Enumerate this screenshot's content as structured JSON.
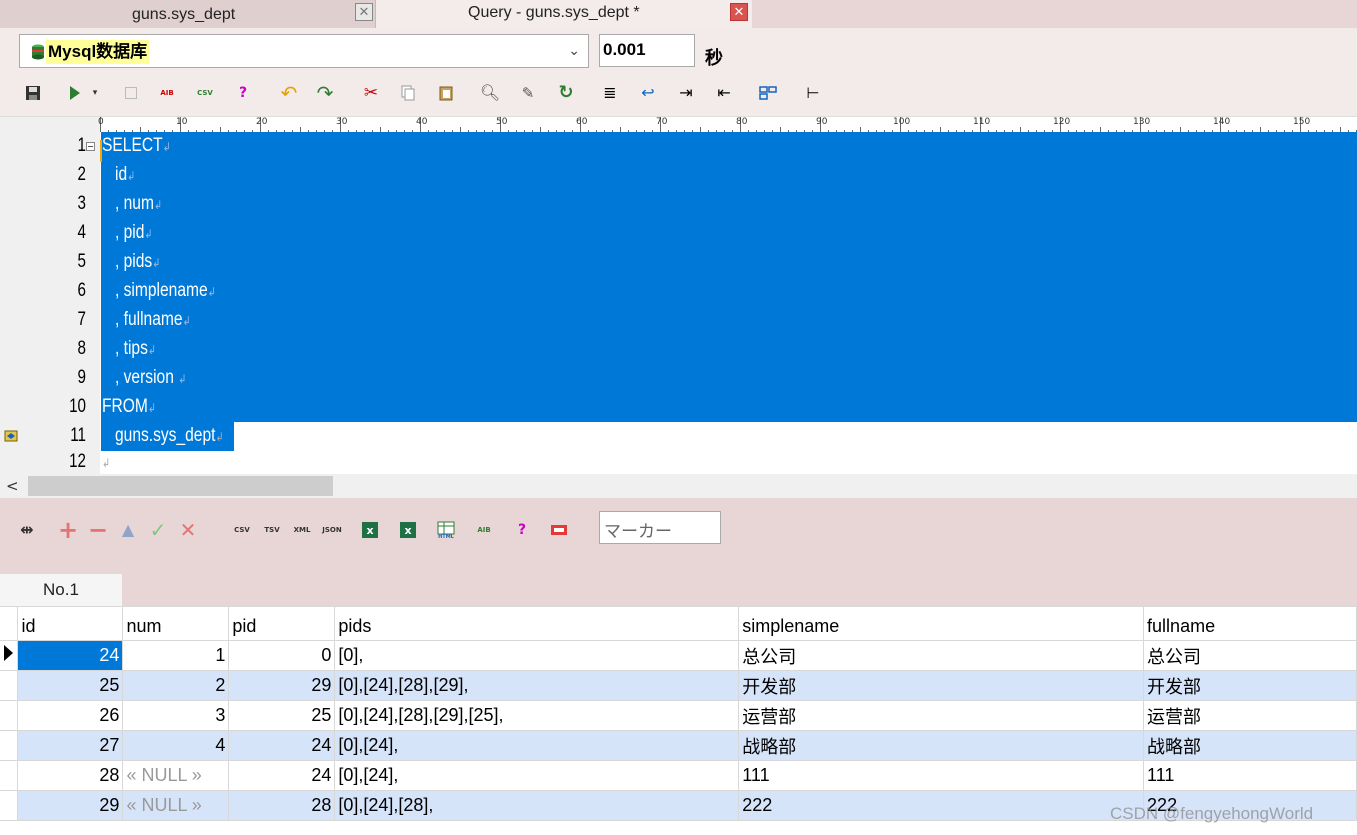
{
  "tabs": [
    {
      "label": "guns.sys_dept",
      "active": false
    },
    {
      "label": "Query - guns.sys_dept *",
      "active": true
    }
  ],
  "connection": {
    "database": "Mysql数据库",
    "exec_time": "0.001",
    "time_unit": "秒"
  },
  "toolbar_icons": [
    "save-icon",
    "run-icon",
    "stop-icon",
    "export-aib-icon",
    "export-csv-icon",
    "help-query-icon",
    "undo-icon",
    "redo-icon",
    "cut-icon",
    "copy-icon",
    "paste-icon",
    "find-icon",
    "replace-icon",
    "goto-icon",
    "align-left-icon",
    "wrap-icon",
    "indent-icon",
    "outdent-icon",
    "layout-icon",
    "tree-icon"
  ],
  "ruler": {
    "labels": [
      "0",
      "10",
      "20",
      "30",
      "40",
      "50",
      "60",
      "70",
      "80",
      "90",
      "100",
      "110",
      "120",
      "130",
      "140",
      "150"
    ]
  },
  "editor": {
    "lines": [
      {
        "num": "1",
        "code": "SELECT"
      },
      {
        "num": "2",
        "code": "   id"
      },
      {
        "num": "3",
        "code": "   , num"
      },
      {
        "num": "4",
        "code": "   , pid"
      },
      {
        "num": "5",
        "code": "   , pids"
      },
      {
        "num": "6",
        "code": "   , simplename"
      },
      {
        "num": "7",
        "code": "   , fullname"
      },
      {
        "num": "8",
        "code": "   , tips"
      },
      {
        "num": "9",
        "code": "   , version "
      },
      {
        "num": "10",
        "code": "FROM"
      },
      {
        "num": "11",
        "code": "   guns.sys_dept"
      },
      {
        "num": "12",
        "code": ""
      }
    ]
  },
  "grid_toolbar": {
    "marker_placeholder": "マーカー"
  },
  "result_tab": "No.1",
  "grid": {
    "columns": [
      "id",
      "num",
      "pid",
      "pids",
      "simplename",
      "fullname"
    ],
    "rows": [
      [
        "24",
        "1",
        "0",
        "[0],",
        "总公司",
        "总公司"
      ],
      [
        "25",
        "2",
        "29",
        "[0],[24],[28],[29],",
        "开发部",
        "开发部"
      ],
      [
        "26",
        "3",
        "25",
        "[0],[24],[28],[29],[25],",
        "运营部",
        "运营部"
      ],
      [
        "27",
        "4",
        "24",
        "[0],[24],",
        "战略部",
        "战略部"
      ],
      [
        "28",
        "« NULL »",
        "24",
        "[0],[24],",
        "111",
        "111"
      ],
      [
        "29",
        "« NULL »",
        "28",
        "[0],[24],[28],",
        "222",
        "222"
      ]
    ]
  },
  "watermark": "CSDN @fengyehongWorld",
  "colors": {
    "selection": "#0078d7",
    "alt_row": "#d6e4fa",
    "chrome": "#e8d6d6"
  }
}
